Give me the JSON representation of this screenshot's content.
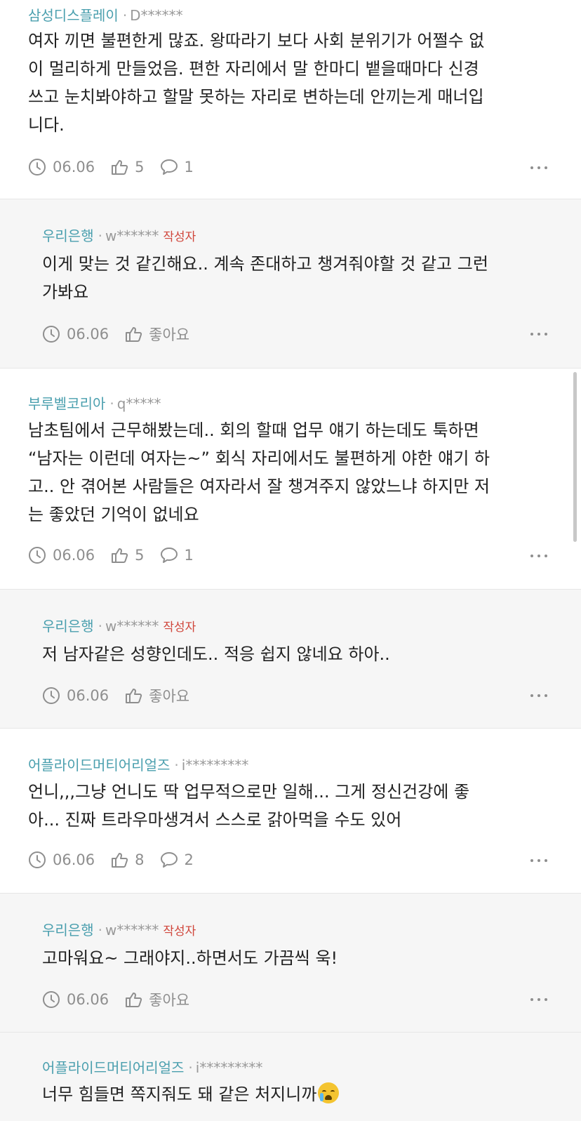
{
  "author_label": "작성자",
  "like_label": "좋아요",
  "icons": {
    "clock": "clock-icon",
    "like": "thumbs-up-icon",
    "reply": "speech-bubble-icon",
    "more": "more-dots-icon"
  },
  "colors": {
    "company": "#4a9fae",
    "author_badge": "#d0463b",
    "reply_bg": "#f6f6f6",
    "meta": "#8e8e8e"
  },
  "comments": [
    {
      "company": "삼성디스플레이",
      "user": "D******",
      "text": "여자 끼면 불편한게 많죠. 왕따라기 보다 사회 분위기가 어쩔수 없\n이 멀리하게 만들었음. 편한 자리에서 말 한마디 뱉을때마다 신경\n쓰고 눈치봐야하고 할말 못하는 자리로 변하는데 안끼는게 매너입\n니다.",
      "date": "06.06",
      "likes": "5",
      "replies": "1"
    },
    {
      "company": "우리은행",
      "user": "w******",
      "text": "이게 맞는 것 같긴해요.. 계속 존대하고 챙겨줘야할 것 같고 그런\n가봐요",
      "date": "06.06"
    },
    {
      "company": "부루벨코리아",
      "user": "q*****",
      "text": "남초팀에서 근무해봤는데.. 회의 할때 업무 얘기 하는데도 툭하면\n“남자는 이런데 여자는~” 회식 자리에서도 불편하게 야한 얘기 하\n고.. 안 겪어본 사람들은 여자라서 잘 챙겨주지 않았느냐 하지만 저\n는 좋았던 기억이 없네요",
      "date": "06.06",
      "likes": "5",
      "replies": "1"
    },
    {
      "company": "우리은행",
      "user": "w******",
      "text": "저 남자같은 성향인데도.. 적응 쉽지 않네요 하아..",
      "date": "06.06"
    },
    {
      "company": "어플라이드머티어리얼즈",
      "user": "i*********",
      "text": "언니,,,그냥 언니도 딱 업무적으로만 일해... 그게 정신건강에 좋\n아... 진짜 트라우마생겨서 스스로 갉아먹을 수도 있어",
      "date": "06.06",
      "likes": "8",
      "replies": "2"
    },
    {
      "company": "우리은행",
      "user": "w******",
      "text": "고마워요~ 그래야지..하면서도 가끔씩 욱!",
      "date": "06.06"
    },
    {
      "company": "어플라이드머티어리얼즈",
      "user": "i*********",
      "text": "너무 힘들면 쪽지줘도 돼 같은 처지니까"
    }
  ]
}
